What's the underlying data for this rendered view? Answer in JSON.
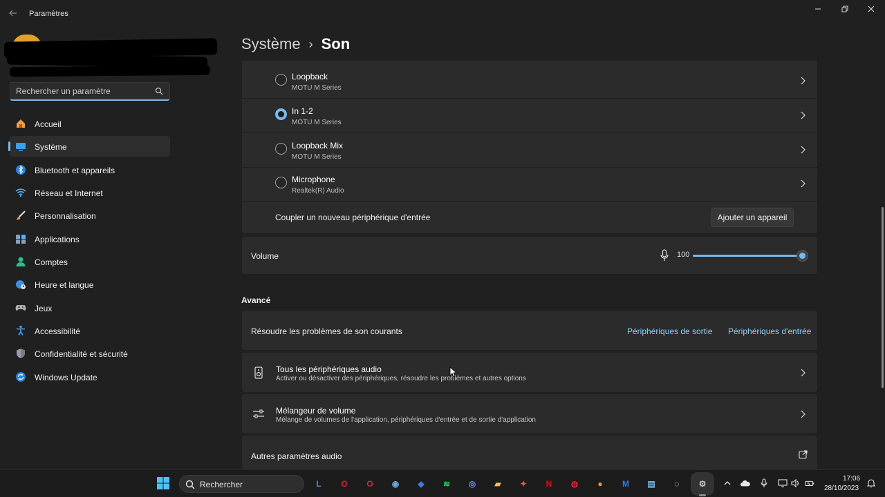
{
  "window": {
    "title": "Paramètres"
  },
  "search": {
    "placeholder": "Rechercher un paramètre"
  },
  "sidebar": {
    "items": [
      {
        "label": "Accueil",
        "icon": "home-icon",
        "active": false
      },
      {
        "label": "Système",
        "icon": "monitor-icon",
        "active": true
      },
      {
        "label": "Bluetooth et appareils",
        "icon": "bluetooth-icon",
        "active": false
      },
      {
        "label": "Réseau et Internet",
        "icon": "wifi-icon",
        "active": false
      },
      {
        "label": "Personnalisation",
        "icon": "brush-icon",
        "active": false
      },
      {
        "label": "Applications",
        "icon": "apps-icon",
        "active": false
      },
      {
        "label": "Comptes",
        "icon": "account-icon",
        "active": false
      },
      {
        "label": "Heure et langue",
        "icon": "globe-clock-icon",
        "active": false
      },
      {
        "label": "Jeux",
        "icon": "gamepad-icon",
        "active": false
      },
      {
        "label": "Accessibilité",
        "icon": "accessibility-icon",
        "active": false
      },
      {
        "label": "Confidentialité et sécurité",
        "icon": "shield-icon",
        "active": false
      },
      {
        "label": "Windows Update",
        "icon": "update-icon",
        "active": false
      }
    ]
  },
  "header": {
    "parent": "Système",
    "separator": "›",
    "current": "Son"
  },
  "input_devices": [
    {
      "name": "Loopback",
      "sub": "MOTU M Series",
      "selected": false
    },
    {
      "name": "In 1-2",
      "sub": "MOTU M Series",
      "selected": true
    },
    {
      "name": "Loopback Mix",
      "sub": "MOTU M Series",
      "selected": false
    },
    {
      "name": "Microphone",
      "sub": "Realtek(R) Audio",
      "selected": false
    }
  ],
  "pair": {
    "label": "Coupler un nouveau périphérique d'entrée",
    "button": "Ajouter un appareil"
  },
  "volume": {
    "label": "Volume",
    "value": "100",
    "level": 1.0
  },
  "advanced": {
    "title": "Avancé",
    "troubleshoot": {
      "label": "Résoudre les problèmes de son courants",
      "link_output": "Périphériques de sortie",
      "link_input": "Périphériques d'entrée"
    },
    "all_devices": {
      "title": "Tous les périphériques audio",
      "sub": "Activer ou désactiver des périphériques, résoudre les problèmes et autres options"
    },
    "mixer": {
      "title": "Mélangeur de volume",
      "sub": "Mélange de volumes de l'application, périphériques d'entrée et de sortie d'application"
    },
    "more": {
      "label": "Autres paramètres audio"
    }
  },
  "taskbar": {
    "search_label": "Rechercher",
    "apps": [
      {
        "name": "l-app-icon",
        "glyph": "L",
        "color": "#2d9ae0"
      },
      {
        "name": "opera-icon",
        "glyph": "O",
        "color": "#e0202a"
      },
      {
        "name": "opera-gx-icon",
        "glyph": "O",
        "color": "#e0204a"
      },
      {
        "name": "steam-icon",
        "glyph": "◉",
        "color": "#6fa8d8"
      },
      {
        "name": "rocket-league-icon",
        "glyph": "◆",
        "color": "#3c7bd8"
      },
      {
        "name": "spotify-icon",
        "glyph": "≋",
        "color": "#1ed760"
      },
      {
        "name": "discord-icon",
        "glyph": "◎",
        "color": "#7b8cf0"
      },
      {
        "name": "file-explorer-icon",
        "glyph": "▰",
        "color": "#f2c744"
      },
      {
        "name": "game-app-icon",
        "glyph": "✦",
        "color": "#e85a3c"
      },
      {
        "name": "netflix-icon",
        "glyph": "N",
        "color": "#e50914"
      },
      {
        "name": "red-app-icon",
        "glyph": "◍",
        "color": "#d8202a"
      },
      {
        "name": "chrome-canary-icon",
        "glyph": "●",
        "color": "#e0a030"
      },
      {
        "name": "motu-icon",
        "glyph": "M",
        "color": "#2f7fd8"
      },
      {
        "name": "notepad-icon",
        "glyph": "▤",
        "color": "#69b8e8"
      },
      {
        "name": "obs-icon",
        "glyph": "◌",
        "color": "#e8e8e8"
      },
      {
        "name": "settings-icon",
        "glyph": "⚙",
        "color": "#c8c8c8",
        "active": true
      }
    ],
    "time": "17:06",
    "date": "28/10/2023"
  }
}
